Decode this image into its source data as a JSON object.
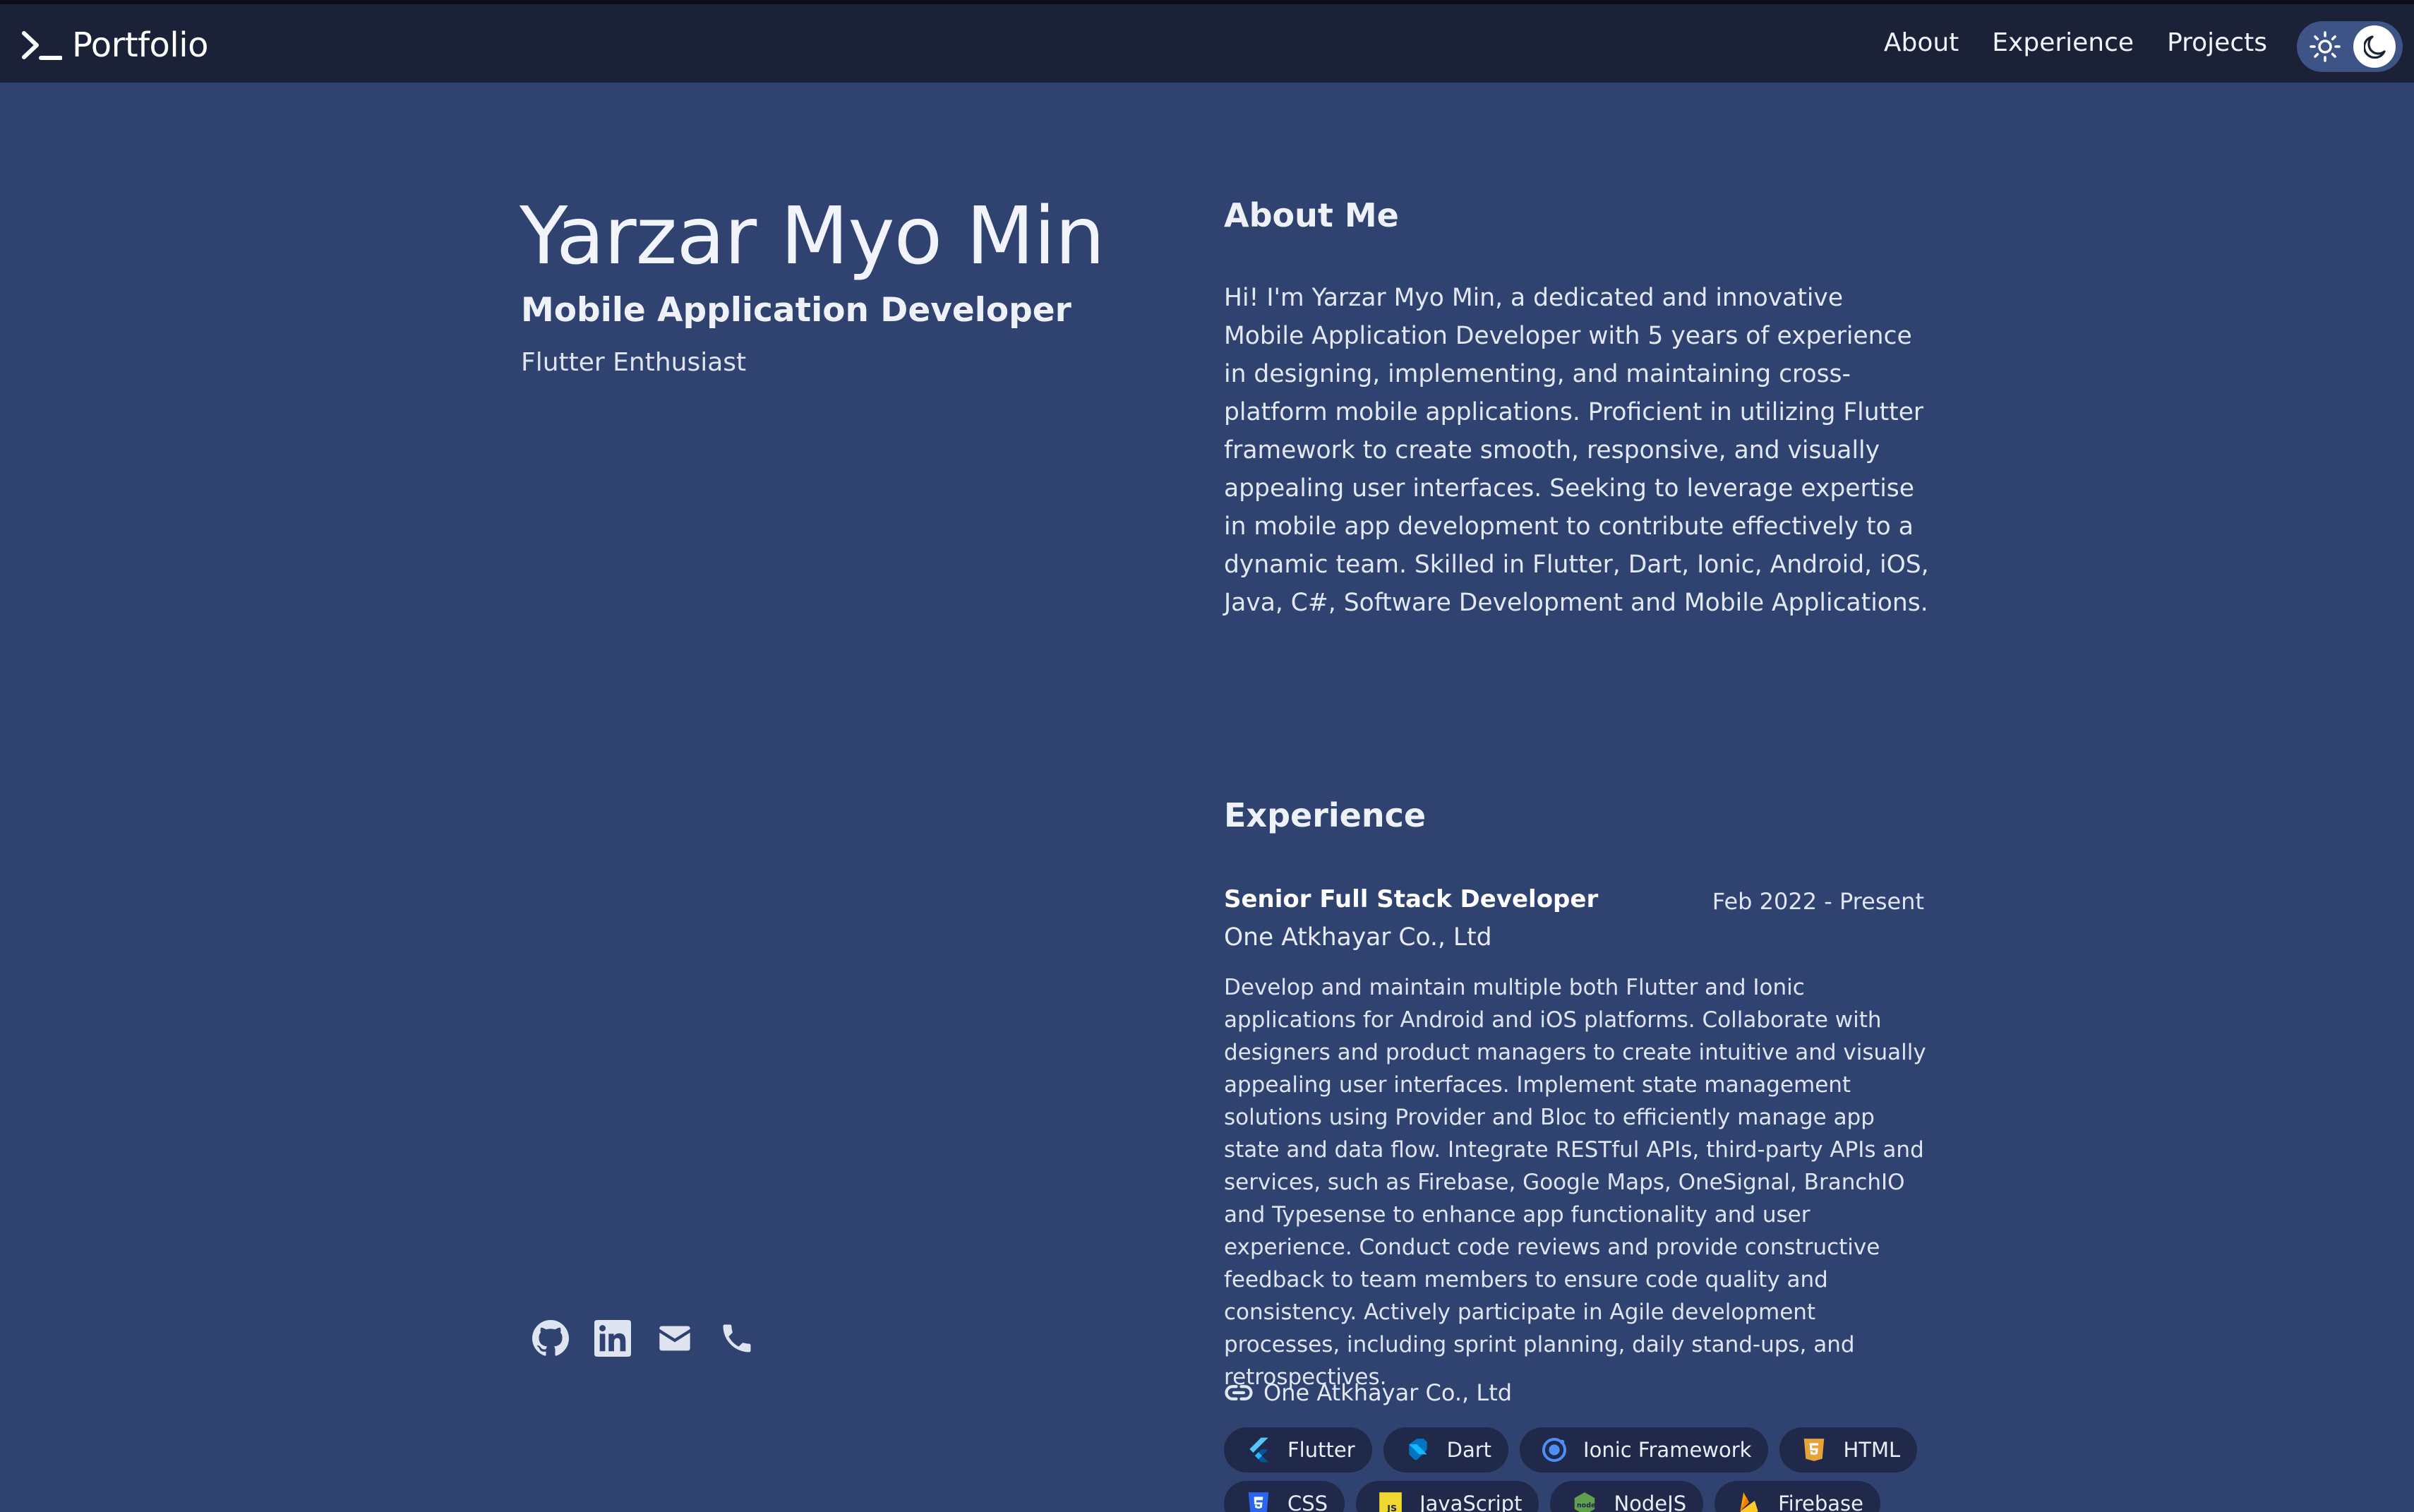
{
  "brand": {
    "title": "Portfolio",
    "icon": "terminal-prompt-icon"
  },
  "nav": {
    "items": [
      "About",
      "Experience",
      "Projects"
    ]
  },
  "theme_toggle": {
    "icons": [
      "sun-icon",
      "moon-icon"
    ],
    "selected": "dark"
  },
  "hero": {
    "name": "Yarzar Myo Min",
    "role": "Mobile Application Developer",
    "tagline": "Flutter Enthusiast"
  },
  "socials": [
    "github-icon",
    "linkedin-icon",
    "email-icon",
    "phone-icon"
  ],
  "about": {
    "heading": "About Me",
    "body": "Hi! I'm Yarzar Myo Min, a dedicated and innovative Mobile Application Developer with 5 years of experience in designing, implementing, and maintaining cross-platform mobile applications. Proficient in utilizing Flutter framework to create smooth, responsive, and visually appealing user interfaces. Seeking to leverage expertise in mobile app development to contribute effectively to a dynamic team. Skilled in Flutter, Dart, Ionic, Android, iOS, Java, C#, Software Development and Mobile Applications."
  },
  "experience": {
    "heading": "Experience",
    "jobs": [
      {
        "title": "Senior Full Stack Developer",
        "dates": "Feb 2022 - Present",
        "company": "One Atkhayar Co., Ltd",
        "description": "Develop and maintain multiple both Flutter and Ionic applications for Android and iOS platforms. Collaborate with designers and product managers to create intuitive and visually appealing user interfaces. Implement state management solutions using Provider and Bloc to efficiently manage app state and data flow. Integrate RESTful APIs, third-party APIs and services, such as Firebase, Google Maps, OneSignal, BranchIO and Typesense to enhance app functionality and user experience. Conduct code reviews and provide constructive feedback to team members to ensure code quality and consistency. Actively participate in Agile development processes, including sprint planning, daily stand-ups, and retrospectives.",
        "link_label": "One Atkhayar Co., Ltd",
        "skills": [
          "Flutter",
          "Dart",
          "Ionic Framework",
          "HTML",
          "CSS",
          "JavaScript",
          "NodeJS",
          "Firebase"
        ]
      }
    ]
  },
  "colors": {
    "page_background": "#2f4270",
    "topbar_background": "#1b2238",
    "chip_background": "#20294a",
    "text": "#e6ebf4"
  }
}
